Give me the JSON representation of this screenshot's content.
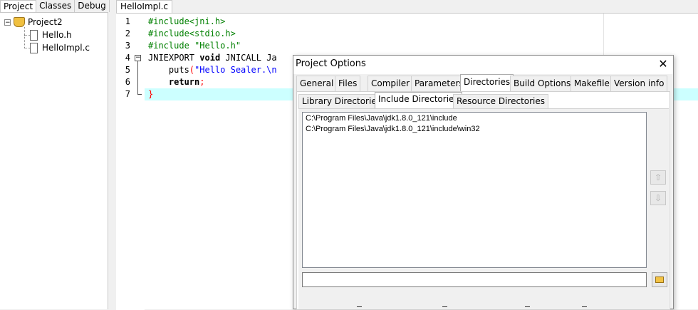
{
  "left_panel": {
    "tabs": [
      "Project",
      "Classes",
      "Debug"
    ],
    "active_tab": "Project",
    "tree": {
      "project": "Project2",
      "files": [
        "Hello.h",
        "HelloImpl.c"
      ]
    }
  },
  "editor": {
    "tab_label": "HelloImpl.c",
    "line_numbers": [
      "1",
      "2",
      "3",
      "4",
      "5",
      "6",
      "7"
    ],
    "lines": {
      "l1": "#include<jni.h>",
      "l2": "#include<stdio.h>",
      "l3": "#include \"Hello.h\"",
      "l4_a": "JNIEXPORT",
      "l4_b": " ",
      "l4_c": "void",
      "l4_d": " JNICALL Ja",
      "l5_a": "    puts",
      "l5_b": "(",
      "l5_c": "\"Hello Sealer.\\n",
      "l6_a": "    return",
      "l6_b": ";",
      "l7": "}"
    },
    "highlighted_line": 7
  },
  "dialog": {
    "title": "Project Options",
    "close_glyph": "✕",
    "tabs": [
      "General",
      "Files",
      "Compiler",
      "Parameters",
      "Directories",
      "Build Options",
      "Makefile",
      "Version info"
    ],
    "active_tab": "Directories",
    "sub_tabs": [
      "Library Directories",
      "Include Directories",
      "Resource Directories"
    ],
    "active_sub_tab": "Include Directories",
    "directories": [
      "C:\\Program Files\\Java\\jdk1.8.0_121\\include",
      "C:\\Program Files\\Java\\jdk1.8.0_121\\include\\win32"
    ],
    "path_input_value": "",
    "move_up_glyph": "⇧",
    "move_down_glyph": "⇩"
  }
}
